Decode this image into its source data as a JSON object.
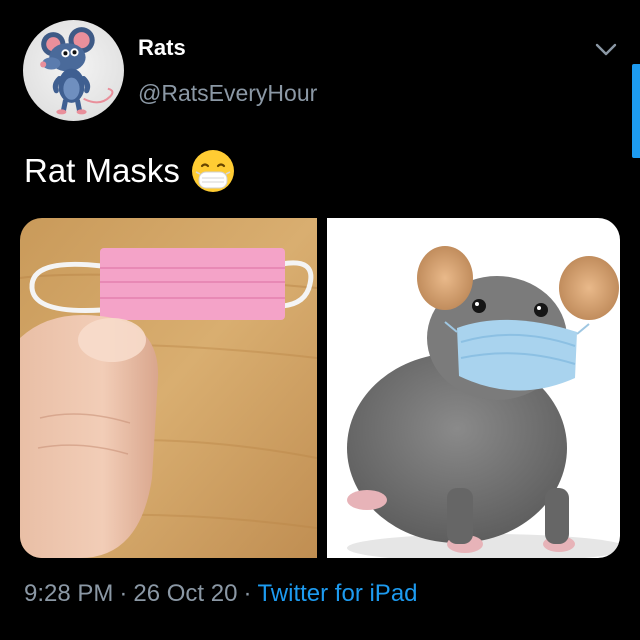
{
  "author": {
    "display_name": "Rats",
    "handle": "@RatsEveryHour",
    "avatar_icon": "cartoon-rat-avatar"
  },
  "tweet": {
    "text": "Rat Masks",
    "emoji_icon": "face-with-medical-mask-emoji"
  },
  "media": {
    "photos": [
      {
        "description_icon": "tiny-pink-mask-on-fingertip-photo"
      },
      {
        "description_icon": "rat-wearing-blue-mask-photo"
      }
    ]
  },
  "meta": {
    "time": "9:28 PM",
    "separator": "·",
    "date": "26 Oct 20",
    "source": "Twitter for iPad"
  },
  "colors": {
    "background": "#000000",
    "primary_text": "#ffffff",
    "secondary_text": "#8b98a5",
    "accent": "#1d9bf0"
  }
}
